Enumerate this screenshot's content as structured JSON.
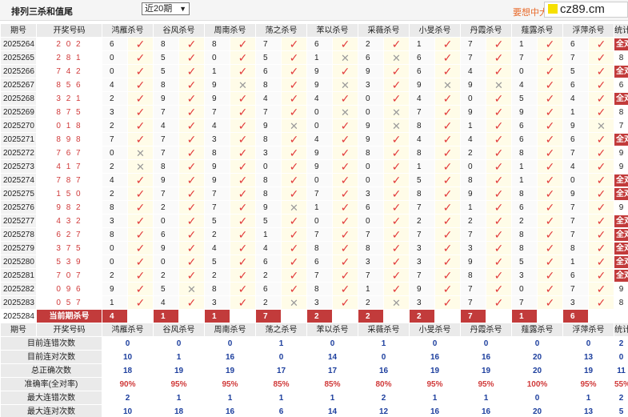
{
  "header": {
    "title": "排列三杀和值尾",
    "period_select": "近20期",
    "promo_text": "要想中大",
    "brand": "cz89.cm"
  },
  "columns": {
    "period": "期号",
    "draw": "开奖号码",
    "experts": [
      "鸿雁杀号",
      "谷风杀号",
      "周南杀号",
      "荡之杀号",
      "苯以杀号",
      "采薇杀号",
      "小旻杀号",
      "丹霞杀号",
      "薤露杀号",
      "浮萍杀号"
    ],
    "stat": "统计"
  },
  "rows": [
    {
      "period": "2025264",
      "draw": "2 0 2",
      "kills": [
        6,
        8,
        8,
        7,
        6,
        2,
        1,
        7,
        1,
        6
      ],
      "ok": [
        1,
        1,
        1,
        1,
        1,
        1,
        1,
        1,
        1,
        1
      ],
      "stat": "全对"
    },
    {
      "period": "2025265",
      "draw": "2 8 1",
      "kills": [
        0,
        5,
        0,
        5,
        1,
        6,
        6,
        7,
        7,
        7
      ],
      "ok": [
        1,
        1,
        1,
        1,
        0,
        0,
        1,
        1,
        1,
        1
      ],
      "stat": "8"
    },
    {
      "period": "2025266",
      "draw": "7 4 2",
      "kills": [
        0,
        5,
        1,
        6,
        9,
        9,
        6,
        4,
        0,
        5
      ],
      "ok": [
        1,
        1,
        1,
        1,
        1,
        1,
        1,
        1,
        1,
        1
      ],
      "stat": "全对"
    },
    {
      "period": "2025267",
      "draw": "8 5 6",
      "kills": [
        4,
        8,
        9,
        8,
        9,
        3,
        9,
        9,
        4,
        6
      ],
      "ok": [
        1,
        1,
        0,
        1,
        0,
        1,
        0,
        0,
        1,
        1
      ],
      "stat": "6"
    },
    {
      "period": "2025268",
      "draw": "3 2 1",
      "kills": [
        2,
        9,
        9,
        4,
        4,
        0,
        4,
        0,
        5,
        4
      ],
      "ok": [
        1,
        1,
        1,
        1,
        1,
        1,
        1,
        1,
        1,
        1
      ],
      "stat": "全对"
    },
    {
      "period": "2025269",
      "draw": "8 7 5",
      "kills": [
        3,
        7,
        7,
        7,
        0,
        0,
        7,
        9,
        9,
        1
      ],
      "ok": [
        1,
        1,
        1,
        1,
        0,
        0,
        1,
        1,
        1,
        1
      ],
      "stat": "8"
    },
    {
      "period": "2025270",
      "draw": "0 1 8",
      "kills": [
        2,
        4,
        4,
        9,
        0,
        9,
        8,
        1,
        6,
        9
      ],
      "ok": [
        1,
        1,
        1,
        0,
        1,
        0,
        1,
        1,
        1,
        0
      ],
      "stat": "7"
    },
    {
      "period": "2025271",
      "draw": "8 9 8",
      "kills": [
        7,
        7,
        3,
        8,
        4,
        9,
        4,
        4,
        6,
        6
      ],
      "ok": [
        1,
        1,
        1,
        1,
        1,
        1,
        1,
        1,
        1,
        1
      ],
      "stat": "全对"
    },
    {
      "period": "2025272",
      "draw": "7 6 7",
      "kills": [
        0,
        7,
        8,
        3,
        9,
        8,
        8,
        2,
        8,
        7
      ],
      "ok": [
        0,
        1,
        1,
        1,
        1,
        1,
        1,
        1,
        1,
        1
      ],
      "stat": "9"
    },
    {
      "period": "2025273",
      "draw": "4 1 7",
      "kills": [
        2,
        8,
        9,
        0,
        9,
        0,
        1,
        0,
        1,
        4
      ],
      "ok": [
        0,
        1,
        1,
        1,
        1,
        1,
        1,
        1,
        1,
        1
      ],
      "stat": "9"
    },
    {
      "period": "2025274",
      "draw": "7 8 7",
      "kills": [
        4,
        9,
        9,
        8,
        0,
        0,
        5,
        8,
        1,
        0
      ],
      "ok": [
        1,
        1,
        1,
        1,
        1,
        1,
        1,
        1,
        1,
        1
      ],
      "stat": "全对"
    },
    {
      "period": "2025275",
      "draw": "1 5 0",
      "kills": [
        2,
        7,
        7,
        8,
        7,
        3,
        8,
        9,
        8,
        9
      ],
      "ok": [
        1,
        1,
        1,
        1,
        1,
        1,
        1,
        1,
        1,
        1
      ],
      "stat": "全对"
    },
    {
      "period": "2025276",
      "draw": "9 8 2",
      "kills": [
        8,
        2,
        7,
        9,
        1,
        6,
        7,
        1,
        6,
        7
      ],
      "ok": [
        1,
        1,
        1,
        0,
        1,
        1,
        1,
        1,
        1,
        1
      ],
      "stat": "9"
    },
    {
      "period": "2025277",
      "draw": "4 3 2",
      "kills": [
        3,
        0,
        5,
        5,
        0,
        0,
        2,
        2,
        2,
        7
      ],
      "ok": [
        1,
        1,
        1,
        1,
        1,
        1,
        1,
        1,
        1,
        1
      ],
      "stat": "全对"
    },
    {
      "period": "2025278",
      "draw": "6 2 7",
      "kills": [
        8,
        6,
        2,
        1,
        7,
        7,
        7,
        7,
        8,
        7
      ],
      "ok": [
        1,
        1,
        1,
        1,
        1,
        1,
        1,
        1,
        1,
        1
      ],
      "stat": "全对"
    },
    {
      "period": "2025279",
      "draw": "3 7 5",
      "kills": [
        0,
        9,
        4,
        4,
        8,
        8,
        3,
        3,
        8,
        8
      ],
      "ok": [
        1,
        1,
        1,
        1,
        1,
        1,
        1,
        1,
        1,
        1
      ],
      "stat": "全对"
    },
    {
      "period": "2025280",
      "draw": "5 3 9",
      "kills": [
        0,
        0,
        5,
        6,
        6,
        3,
        3,
        9,
        5,
        1
      ],
      "ok": [
        1,
        1,
        1,
        1,
        1,
        1,
        1,
        1,
        1,
        1
      ],
      "stat": "全对"
    },
    {
      "period": "2025281",
      "draw": "7 0 7",
      "kills": [
        2,
        2,
        2,
        2,
        7,
        7,
        7,
        8,
        3,
        6
      ],
      "ok": [
        1,
        1,
        1,
        1,
        1,
        1,
        1,
        1,
        1,
        1
      ],
      "stat": "全对"
    },
    {
      "period": "2025282",
      "draw": "0 9 6",
      "kills": [
        9,
        5,
        8,
        6,
        8,
        1,
        9,
        7,
        0,
        7
      ],
      "ok": [
        1,
        0,
        1,
        1,
        1,
        1,
        1,
        1,
        1,
        1
      ],
      "stat": "9"
    },
    {
      "period": "2025283",
      "draw": "0 5 7",
      "kills": [
        1,
        4,
        3,
        2,
        3,
        2,
        3,
        7,
        7,
        3
      ],
      "ok": [
        1,
        1,
        1,
        0,
        1,
        0,
        1,
        1,
        1,
        1
      ],
      "stat": "8"
    }
  ],
  "current": {
    "period": "2025284",
    "label": "当前期杀号",
    "kills": [
      4,
      1,
      1,
      7,
      2,
      2,
      2,
      7,
      1,
      6
    ]
  },
  "footer_header": {
    "period": "期号",
    "draw": "开奖号码"
  },
  "summary": [
    {
      "label": "目前连错次数",
      "values": [
        "0",
        "0",
        "0",
        "1",
        "0",
        "1",
        "0",
        "0",
        "0",
        "0"
      ],
      "stat": "2"
    },
    {
      "label": "目前连对次数",
      "values": [
        "10",
        "1",
        "16",
        "0",
        "14",
        "0",
        "16",
        "16",
        "20",
        "13"
      ],
      "stat": "0"
    },
    {
      "label": "总正确次数",
      "values": [
        "18",
        "19",
        "19",
        "17",
        "17",
        "16",
        "19",
        "19",
        "20",
        "19"
      ],
      "stat": "11"
    },
    {
      "label": "准确率(全对率)",
      "values": [
        "90%",
        "95%",
        "95%",
        "85%",
        "85%",
        "80%",
        "95%",
        "95%",
        "100%",
        "95%"
      ],
      "stat": "55%",
      "red": true
    },
    {
      "label": "最大连错次数",
      "values": [
        "2",
        "1",
        "1",
        "1",
        "1",
        "2",
        "1",
        "1",
        "0",
        "1"
      ],
      "stat": "2"
    },
    {
      "label": "最大连对次数",
      "values": [
        "10",
        "18",
        "16",
        "6",
        "14",
        "12",
        "16",
        "16",
        "20",
        "13"
      ],
      "stat": "5"
    }
  ],
  "marks": {
    "ok": "✓",
    "bad": "✕"
  }
}
